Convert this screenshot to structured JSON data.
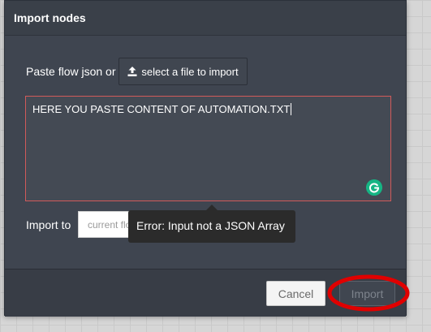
{
  "dialog": {
    "title": "Import nodes",
    "paste_label": "Paste flow json or",
    "file_button_label": "select a file to import",
    "file_button_icon": "upload-icon",
    "textarea_value": "HERE YOU PASTE CONTENT OF AUTOMATION.TXT",
    "grammarly_icon": "grammarly-icon",
    "import_to_label": "Import to",
    "import_to_value": "current flow",
    "error_tooltip": "Error: Input not a JSON Array",
    "cancel_label": "Cancel",
    "import_label": "Import"
  },
  "colors": {
    "dialog_background": "#3f4550",
    "textarea_error_border": "#d15a5a",
    "tooltip_background": "#2b2b2b",
    "annotation_circle": "#e00000",
    "grammarly": "#16b584"
  }
}
